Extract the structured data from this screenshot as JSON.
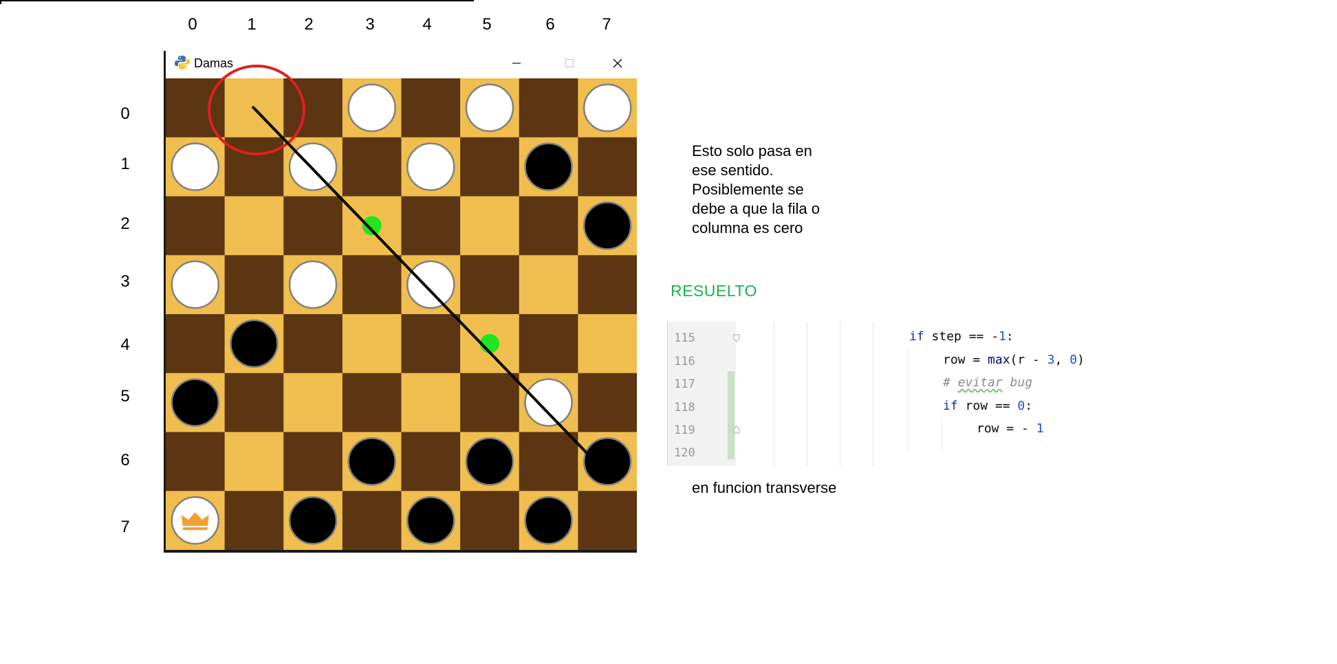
{
  "board_columns": [
    "0",
    "1",
    "2",
    "3",
    "4",
    "5",
    "6",
    "7"
  ],
  "board_rows": [
    "0",
    "1",
    "2",
    "3",
    "4",
    "5",
    "6",
    "7"
  ],
  "window": {
    "title": "Damas",
    "icon": "python-icon",
    "buttons": [
      "minimize-icon",
      "maximize-icon",
      "close-icon"
    ]
  },
  "colors": {
    "light_square": "#f0be4e",
    "dark_square": "#5c3512",
    "white_piece": "#ffffff",
    "black_piece": "#000000",
    "piece_border": "#808080",
    "move_marker": "#1fe61f",
    "highlight_circle": "#e02020",
    "crown": "#f0a030",
    "resuelto": "#1bb34a"
  },
  "pieces": [
    {
      "row": 0,
      "col": 3,
      "color": "white"
    },
    {
      "row": 0,
      "col": 5,
      "color": "white"
    },
    {
      "row": 0,
      "col": 7,
      "color": "white"
    },
    {
      "row": 1,
      "col": 0,
      "color": "white"
    },
    {
      "row": 1,
      "col": 2,
      "color": "white"
    },
    {
      "row": 1,
      "col": 4,
      "color": "white"
    },
    {
      "row": 1,
      "col": 6,
      "color": "black"
    },
    {
      "row": 2,
      "col": 7,
      "color": "black"
    },
    {
      "row": 3,
      "col": 0,
      "color": "white"
    },
    {
      "row": 3,
      "col": 2,
      "color": "white"
    },
    {
      "row": 3,
      "col": 4,
      "color": "white"
    },
    {
      "row": 4,
      "col": 1,
      "color": "black"
    },
    {
      "row": 5,
      "col": 0,
      "color": "black"
    },
    {
      "row": 5,
      "col": 6,
      "color": "white"
    },
    {
      "row": 6,
      "col": 3,
      "color": "black"
    },
    {
      "row": 6,
      "col": 5,
      "color": "black"
    },
    {
      "row": 6,
      "col": 7,
      "color": "black"
    },
    {
      "row": 7,
      "col": 0,
      "color": "white",
      "king": true
    },
    {
      "row": 7,
      "col": 2,
      "color": "black"
    },
    {
      "row": 7,
      "col": 4,
      "color": "black"
    },
    {
      "row": 7,
      "col": 6,
      "color": "black"
    }
  ],
  "valid_moves": [
    {
      "row": 2,
      "col": 3
    },
    {
      "row": 4,
      "col": 5
    }
  ],
  "note_lines": [
    "Esto solo pasa en",
    "ese sentido.",
    "Posiblemente se",
    "debe a que la fila o",
    "columna es cero"
  ],
  "resuelto": "RESUELTO",
  "code": {
    "line_numbers": [
      "115",
      "116",
      "117",
      "118",
      "119",
      "120"
    ],
    "kw_if": "if",
    "l1_a": " step == -",
    "l1_num": "1",
    "l1_b": ":",
    "l2_a": "row = ",
    "l2_fn": "max",
    "l2_b": "(r - ",
    "l2_num1": "3",
    "l2_c": ", ",
    "l2_num2": "0",
    "l2_d": ")",
    "l3_hash": "# ",
    "l3_word": "evitar",
    "l3_rest": " bug",
    "l4_a": " row == ",
    "l4_num": "0",
    "l4_b": ":",
    "l5_a": "row = - ",
    "l5_num": "1"
  },
  "caption": "en funcion transverse"
}
